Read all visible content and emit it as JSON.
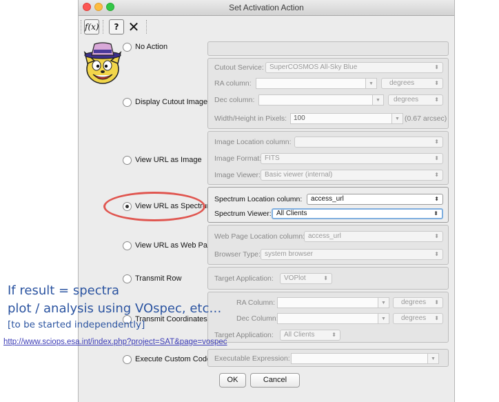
{
  "window": {
    "title": "Set Activation Action"
  },
  "toolbar": {
    "fx_label": "f(x)",
    "help_label": "?",
    "close_label": "✕"
  },
  "actions": {
    "no_action": "No Action",
    "display_cutout": "Display Cutout Image",
    "view_image": "View URL as Image",
    "view_spectrum": "View URL as Spectrum",
    "view_webpage": "View URL as Web Page",
    "transmit_row": "Transmit Row",
    "transmit_coords": "Transmit Coordinates",
    "execute_code": "Execute Custom Code",
    "selected": "view_spectrum"
  },
  "cutout": {
    "service_label": "Cutout Service:",
    "service_value": "SuperCOSMOS All-Sky Blue",
    "ra_label": "RA column:",
    "ra_value": "",
    "ra_units": "degrees",
    "dec_label": "Dec column:",
    "dec_value": "",
    "dec_units": "degrees",
    "size_label": "Width/Height in Pixels:",
    "size_value": "100",
    "size_arcsec": "(0.67 arcsec)"
  },
  "image": {
    "location_label": "Image Location column:",
    "location_value": "",
    "format_label": "Image Format:",
    "format_value": "FITS",
    "viewer_label": "Image Viewer:",
    "viewer_value": "Basic viewer (internal)"
  },
  "spectrum": {
    "location_label": "Spectrum Location column:",
    "location_value": "access_url",
    "viewer_label": "Spectrum Viewer:",
    "viewer_value": "All Clients"
  },
  "webpage": {
    "location_label": "Web Page Location column:",
    "location_value": "access_url",
    "browser_label": "Browser Type:",
    "browser_value": "system browser"
  },
  "transmit_row": {
    "target_label": "Target Application:",
    "target_value": "VOPlot"
  },
  "transmit_coords": {
    "ra_label": "RA Column:",
    "ra_value": "",
    "ra_units": "degrees",
    "dec_label": "Dec Column:",
    "dec_value": "",
    "dec_units": "degrees",
    "target_label": "Target Application:",
    "target_value": "All Clients"
  },
  "custom": {
    "expr_label": "Executable Expression:",
    "expr_value": ""
  },
  "buttons": {
    "ok": "OK",
    "cancel": "Cancel"
  },
  "annotation": {
    "line1": "If result = spectra",
    "line2": "plot / analysis using  VOspec, etc…",
    "line3": "[to be started independently]",
    "link": "http://www.sciops.esa.int/index.php?project=SAT&page=vospec"
  },
  "colors": {
    "highlight_ring": "#e05650",
    "annotation_text": "#2a53a0",
    "selection": "#7eaedf"
  }
}
